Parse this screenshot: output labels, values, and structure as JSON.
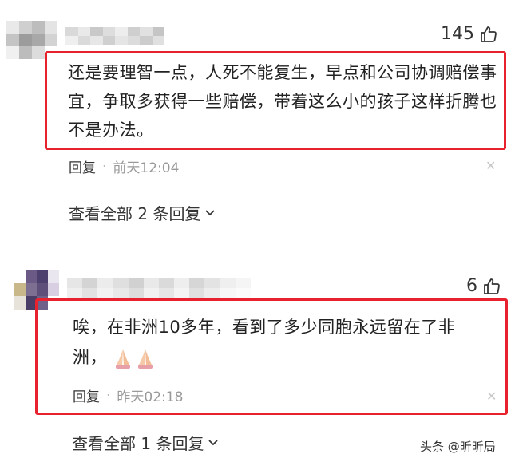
{
  "comments": [
    {
      "likes": "145",
      "text": "还是要理智一点，人死不能复生，早点和公司协调赔偿事宜，争取多获得一些赔偿，带着这么小的孩子这样折腾也不是办法。",
      "reply_label": "回复",
      "time": "前天12:04",
      "view_all": "查看全部 2 条回复"
    },
    {
      "likes": "6",
      "text": "唉，在非洲10多年，看到了多少同胞永远留在了非洲，",
      "emoji": "pray-hands-emoji",
      "reply_label": "回复",
      "time": "昨天02:18",
      "view_all": "查看全部 1 条回复"
    }
  ],
  "icons": {
    "like": "thumbs-up-icon",
    "close": "close-icon",
    "expand": "chevron-down-icon"
  },
  "colors": {
    "highlight_border": "#e8212e",
    "time_text": "#999999"
  },
  "watermark": "头条 @昕昕局"
}
